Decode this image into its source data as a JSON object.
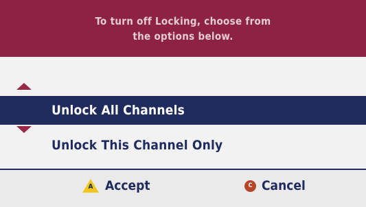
{
  "dialog": {
    "message_line1": "To turn off Locking, choose from",
    "message_line2": "the options below."
  },
  "options": [
    {
      "label": "Unlock All Channels",
      "selected": true
    },
    {
      "label": "Unlock This Channel Only",
      "selected": false
    }
  ],
  "scroll": {
    "up_icon": "triangle-up",
    "down_icon": "triangle-down"
  },
  "footer": {
    "accept_icon_glyph": "A",
    "accept_label": "Accept",
    "cancel_icon_glyph": "C",
    "cancel_label": "Cancel"
  },
  "colors": {
    "header_bg": "#8e2244",
    "highlight_bg": "#1e2b5c",
    "text_navy": "#1f2b5e",
    "accept_yellow": "#f1c61a",
    "cancel_red": "#b6452a"
  }
}
